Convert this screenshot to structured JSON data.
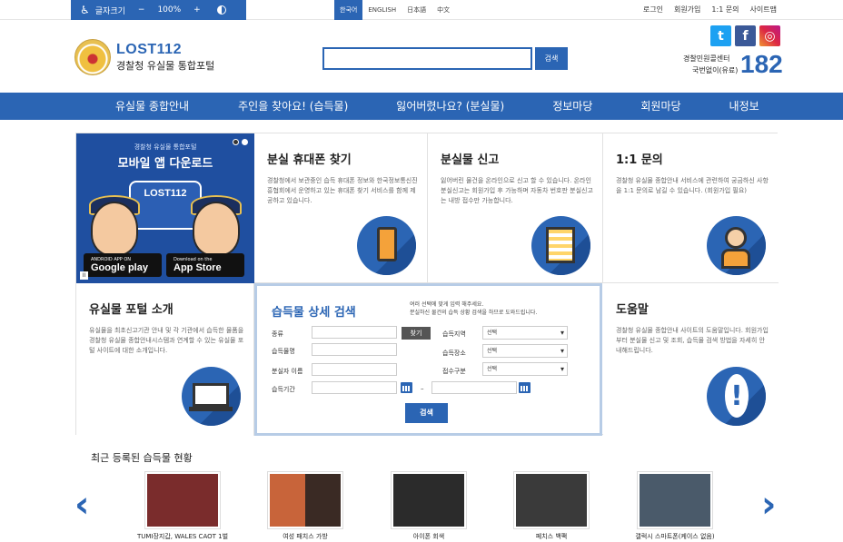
{
  "a11y": {
    "font_size": "글자크기",
    "minus": "−",
    "percent": "100%",
    "plus": "+"
  },
  "langs": [
    "한국어",
    "ENGLISH",
    "日本語",
    "中文"
  ],
  "toplinks": [
    "로그인",
    "회원가입",
    "1:1 문의",
    "사이트맵"
  ],
  "logo": {
    "title": "LOST112",
    "subtitle": "경찰청 유실물 통합포털"
  },
  "search": {
    "button": "검색",
    "value": ""
  },
  "social": [
    "twitter-icon",
    "facebook-icon",
    "instagram-icon"
  ],
  "callcenter": {
    "label1": "경찰민원콜센터",
    "label2": "국번없이(유료)",
    "number": "182"
  },
  "nav": [
    "유실물 종합안내",
    "주인을 찾아요! (습득물)",
    "잃어버렸나요? (분실물)",
    "정보마당",
    "회원마당",
    "내정보"
  ],
  "banner": {
    "top": "경찰청 유실물 통합포털",
    "title": "모바일 앱 다운로드",
    "badge": "LOST112",
    "google_small": "ANDROID APP ON",
    "google_big": "Google play",
    "apple_small": "Download on the",
    "apple_big": "App Store"
  },
  "cards": {
    "phone": {
      "title": "분실 휴대폰 찾기",
      "desc": "경찰청에서 보관중인 습득 휴대폰 정보와 한국정보통신진흥협회에서 운영하고 있는 휴대폰 찾기 서비스를 함께 제공하고 있습니다."
    },
    "report": {
      "title": "분실물 신고",
      "desc": "잃어버린 물건을 온라인으로 신고 할 수 있습니다. 온라인 분실신고는 회원가입 후 가능하며 자동차 번호판 분실신고는 내방 접수만 가능합니다."
    },
    "inquiry": {
      "title": "1:1 문의",
      "desc": "경찰청 유실물 종합안내 서비스에 관련하여 궁금하신 사항을 1:1 문의로 남길 수 있습니다. (회원가입 필요)"
    },
    "intro": {
      "title": "유실물 포털 소개",
      "desc": "유실물을 최초신고기관 안내 및 각 기관에서 습득한 물품을 경찰청 유실물 종합안내시스템과 연계할 수 있는 유실물 포털 사이트에 대한 소개입니다."
    },
    "help": {
      "title": "도움말",
      "desc": "경찰청 유실물 종합안내 사이트의 도움말입니다. 회원가입부터 분실물 신고 및 조회, 습득물 검색 방법을 자세히 안내해드립니다."
    }
  },
  "detail": {
    "title": "습득물 상세 검색",
    "hint1": "여러 선택에 맞게 입력 해주세요.",
    "hint2": "분실하신 물건의 습득 상황 검색을 하므로 도와드립니다.",
    "labels": {
      "kind": "종류",
      "name": "습득물명",
      "date": "분실자 이름",
      "period": "습득기간",
      "region": "습득지역",
      "place": "습득장소",
      "reception": "접수구분"
    },
    "find_btn": "찾기",
    "select_default": "선택",
    "dash": "–",
    "search_btn": "검색"
  },
  "recent": {
    "title": "최근 등록된 습득물 현황",
    "items": [
      {
        "label": "TUMI장지갑, WALES CAOT 1벌",
        "color": "#7a2c2c"
      },
      {
        "label": "여성 패치스 가방",
        "color": "#c8643a"
      },
      {
        "label": "아이폰 회색",
        "color": "#2b2b2b"
      },
      {
        "label": "페치스 백팩",
        "color": "#3a3a3a"
      },
      {
        "label": "갤럭시 스마트폰(케이스 없음)",
        "color": "#4a5a6a"
      }
    ]
  },
  "colors": {
    "primary": "#2b65b4",
    "dark": "#1e4f96"
  }
}
